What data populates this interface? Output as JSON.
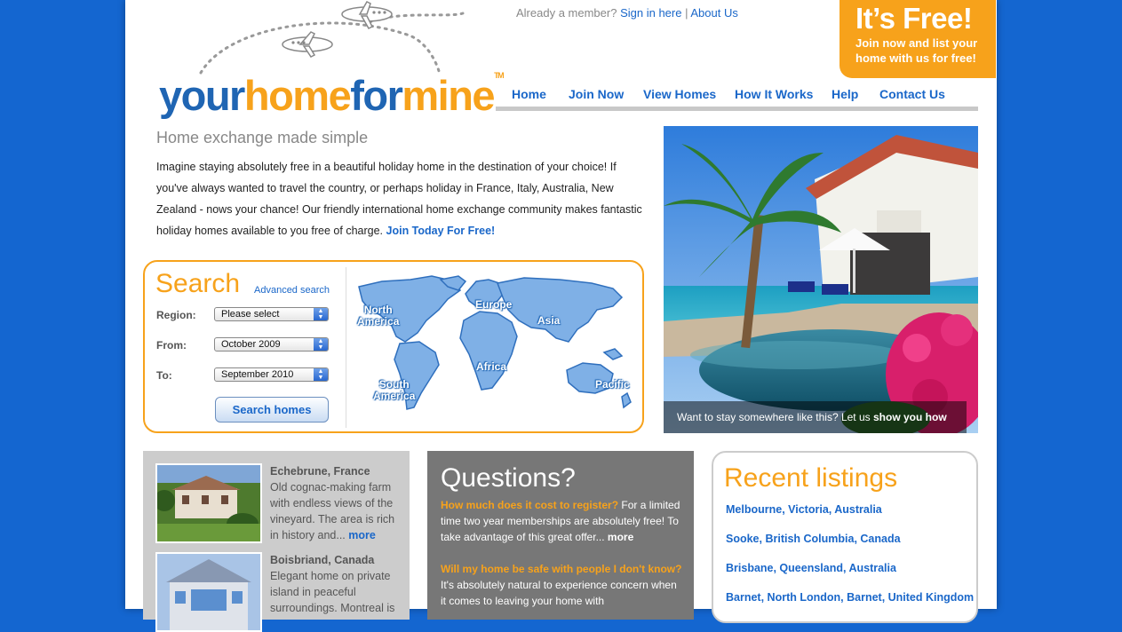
{
  "colors": {
    "background": "#1466d0",
    "accent": "#f7a21b",
    "link": "#1a67c9",
    "logo_blue": "#1f65b3"
  },
  "topbar": {
    "prefix": "Already a member?",
    "sign_in": "Sign in here",
    "separator": "|",
    "about": "About Us"
  },
  "badge": {
    "headline": "It’s Free!",
    "line1": "Join now and list your",
    "line2": "home with us for free!"
  },
  "logo": {
    "part1": "your",
    "part2": "home",
    "part3": "for",
    "part4": "mine",
    "tm": "TM"
  },
  "nav": [
    "Home",
    "Join Now",
    "View Homes",
    "How It Works",
    "Help",
    "Contact Us"
  ],
  "intro": {
    "title": "Home exchange made simple",
    "text": "Imagine staying absolutely free in a beautiful holiday home in the destination of your choice! If you've always wanted to travel the country, or perhaps holiday in France, Italy, Australia, New Zealand - nows your chance! Our friendly international home exchange community makes fantastic holiday homes available to you free of charge.",
    "cta": "Join Today For Free!"
  },
  "search": {
    "title": "Search",
    "advanced": "Advanced search",
    "region_label": "Region:",
    "region_value": "Please select",
    "from_label": "From:",
    "from_value": "October 2009",
    "to_label": "To:",
    "to_value": "September 2010",
    "button": "Search homes",
    "map_regions": {
      "north_america_1": "North",
      "north_america_2": "America",
      "europe": "Europe",
      "asia": "Asia",
      "africa": "Africa",
      "south_america_1": "South",
      "south_america_2": "America",
      "pacific": "Pacific"
    }
  },
  "hero": {
    "caption_prefix": "Want to stay somewhere like this? Let us",
    "caption_link": "show you how"
  },
  "properties": [
    {
      "title": "Echebrune, France",
      "text": "Old cognac-making farm with endless views of the vineyard. The area is rich in history and...",
      "more": "more"
    },
    {
      "title": "Boisbriand, Canada",
      "text": "Elegant home on private island in peaceful surroundings. Montreal is"
    }
  ],
  "questions": {
    "title": "Questions?",
    "q1": "How much does it cost to register?",
    "a1": "For a limited time two year memberships are absolutely free! To take advantage of this great offer...",
    "a1_more": "more",
    "q2": "Will my home be safe with people I don't know?",
    "a2": "It's absolutely natural to experience concern when it comes to leaving your home with"
  },
  "listings": {
    "title": "Recent listings",
    "items": [
      "Melbourne, Victoria, Australia",
      "Sooke, British Columbia, Canada",
      "Brisbane, Queensland, Australia",
      "Barnet, North London, Barnet, United Kingdom"
    ]
  }
}
